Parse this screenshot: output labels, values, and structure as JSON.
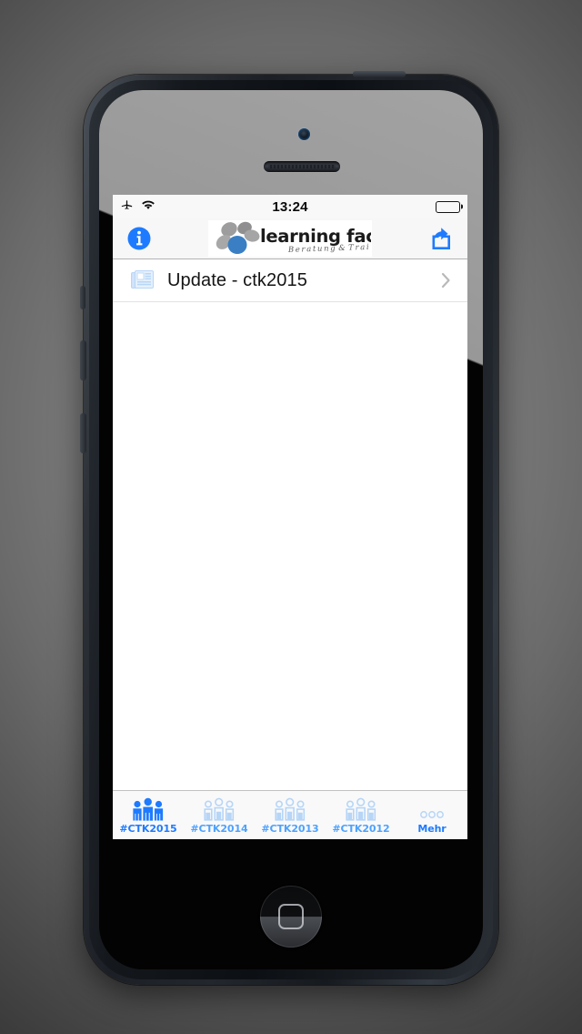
{
  "device": {
    "name": "iphone-5-black",
    "home_button": "home-button"
  },
  "status_bar": {
    "airplane_icon": "airplane-icon",
    "wifi_icon": "wifi-icon",
    "time": "13:24",
    "battery_icon": "battery-full-icon"
  },
  "nav_bar": {
    "info_label": "i",
    "info_icon": "info-circle-icon",
    "share_icon": "share-icon",
    "logo": {
      "title": "learning factory",
      "subtitle": "Beratung & Training",
      "icon": "learning-factory-logo"
    }
  },
  "list": {
    "rows": [
      {
        "icon": "news-document-icon",
        "label": "Update - ctk2015",
        "chevron": "chevron-right-icon"
      }
    ]
  },
  "tab_bar": {
    "tabs": [
      {
        "label": "#CTK2015",
        "icon": "people-group-filled-icon",
        "state": "active"
      },
      {
        "label": "#CTK2014",
        "icon": "people-group-outline-icon",
        "state": "inactive"
      },
      {
        "label": "#CTK2013",
        "icon": "people-group-outline-icon",
        "state": "inactive"
      },
      {
        "label": "#CTK2012",
        "icon": "people-group-outline-icon",
        "state": "inactive"
      },
      {
        "label": "Mehr",
        "icon": "more-dots-icon",
        "state": "more"
      }
    ]
  },
  "colors": {
    "accent_blue": "#1e7bff",
    "inactive_blue": "#a8cdf5",
    "label_blue": "#4da2ff",
    "status_bar_bg": "#f8f8f8",
    "nav_bar_bg": "#f7f7f7",
    "tab_bar_bg": "#f9f9f9"
  }
}
